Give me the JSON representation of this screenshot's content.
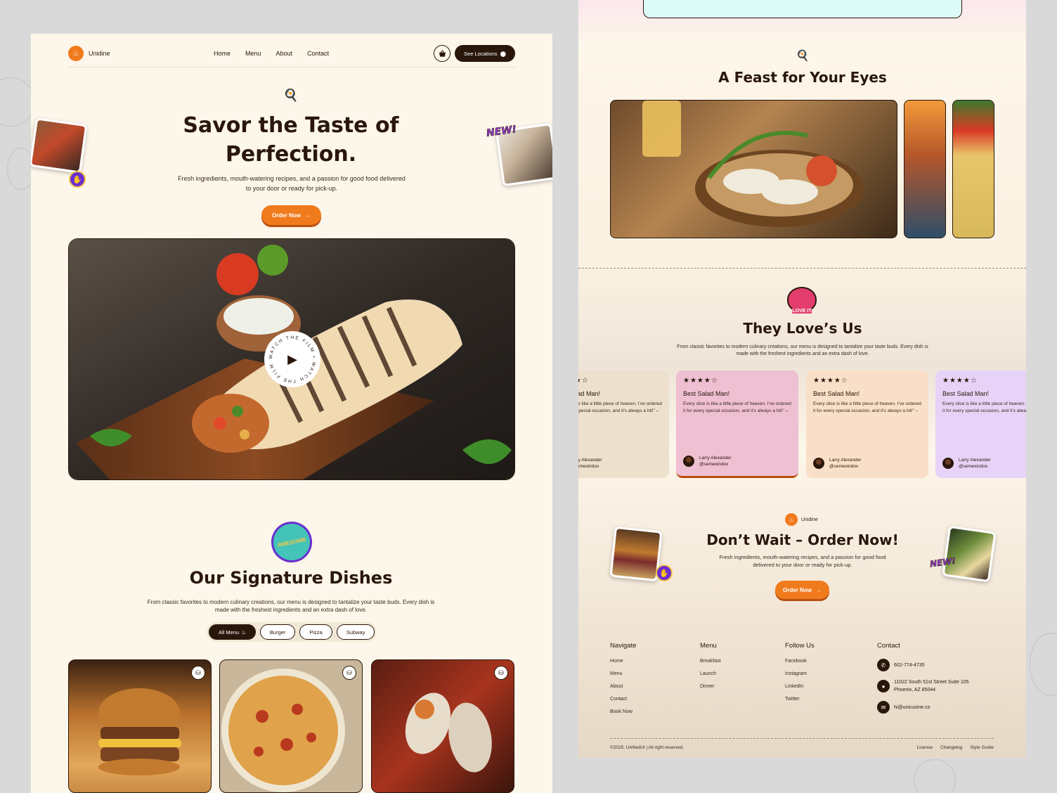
{
  "brand": {
    "name": "Unidine",
    "accent": "#f07b1d",
    "dark": "#2a170b",
    "cream": "#fdf6ea"
  },
  "nav": {
    "links": [
      "Home",
      "Menu",
      "About",
      "Contact"
    ],
    "cart_icon": "basket-icon",
    "locations_label": "See Locations"
  },
  "hero": {
    "title_line1": "Savor the Taste of",
    "title_line2": "Perfection.",
    "subtitle": "Fresh ingredients, mouth-watering recipes, and a passion for good food delivered to your door or ready for pick-up.",
    "order_label": "Order Now",
    "new_tag": "NEW!",
    "video_ring_text": "WATCH THE FILM • WATCH THE FILM •"
  },
  "signature": {
    "badge_text": "AWESOME",
    "title": "Our Signature Dishes",
    "subtitle": "From classic favorites to modern culinary creations, our menu is designed to tantalize your taste buds. Every dish is made with the freshest ingredients and an extra dash of love.",
    "filters": [
      "All Menu",
      "Burger",
      "Pizza",
      "Subway"
    ],
    "active_filter": "All Menu"
  },
  "feast": {
    "title": "A Feast for Your Eyes"
  },
  "testimonials": {
    "badge_text": "LOVE IT",
    "title": "They Love’s Us",
    "subtitle": "From classic favorites to modern culinary creations, our menu is designed to tantalize your taste buds. Every dish is made with the freshest ingredients and an extra dash of love.",
    "reviews": [
      {
        "stars": "★★★★☆",
        "title": "Best Salad Man!",
        "text": "Every slice is like a little piece of heaven. I’ve ordered it for every special occasion, and it’s always a hit!” –",
        "name": "Larry Alexander",
        "handle": "@semexindox",
        "color": "#ede0cc",
        "rating": 4
      },
      {
        "stars": "★★★★☆",
        "title": "Best Salad Man!",
        "text": "Every slice is like a little piece of heaven. I’ve ordered it for every special occasion, and it’s always a hit!” –",
        "name": "Larry Alexander",
        "handle": "@semexindox",
        "color": "#efbfd2",
        "rating": 4
      },
      {
        "stars": "★★★★☆",
        "title": "Best Salad Man!",
        "text": "Every slice is like a little piece of heaven. I’ve ordered it for every special occasion, and it’s always a hit!” –",
        "name": "Larry Alexander",
        "handle": "@semexindox",
        "color": "#f9dfc7",
        "rating": 4
      },
      {
        "stars": "★★★★☆",
        "title": "Best Salad Man!",
        "text": "Every slice is like a little piece of heaven. I’ve ordered it for every special occasion, and it’s always a hit!” –",
        "name": "Larry Alexander",
        "handle": "@semexindox",
        "color": "#e7d3f7",
        "rating": 4
      }
    ]
  },
  "cta": {
    "logo": "Unidine",
    "title": "Don’t Wait – Order Now!",
    "subtitle": "Fresh ingredients, mouth-watering recipes, and a passion for good food delivered to your door or ready for pick-up.",
    "order_label": "Order Now",
    "new_tag": "NEW!"
  },
  "footer": {
    "navigate": {
      "title": "Navigate",
      "items": [
        "Home",
        "Menu",
        "About",
        "Contact",
        "Book Now"
      ]
    },
    "menu": {
      "title": "Menu",
      "items": [
        "Breakfast",
        "Launch",
        "Dinner"
      ]
    },
    "follow": {
      "title": "Follow Us",
      "items": [
        "Facebook",
        "Instagram",
        "LinkedIn",
        "Twitter"
      ]
    },
    "contact": {
      "title": "Contact",
      "phone": "602-774-4735",
      "address_line1": "11022 South 51st Street Suite 105",
      "address_line2": "Phoenix, AZ 85044",
      "email": "hi@unicusine.co"
    },
    "copyright": "©2025. UnifiedUI | All right reserved.",
    "links": [
      "License",
      "Changelog",
      "Style Guide"
    ]
  }
}
